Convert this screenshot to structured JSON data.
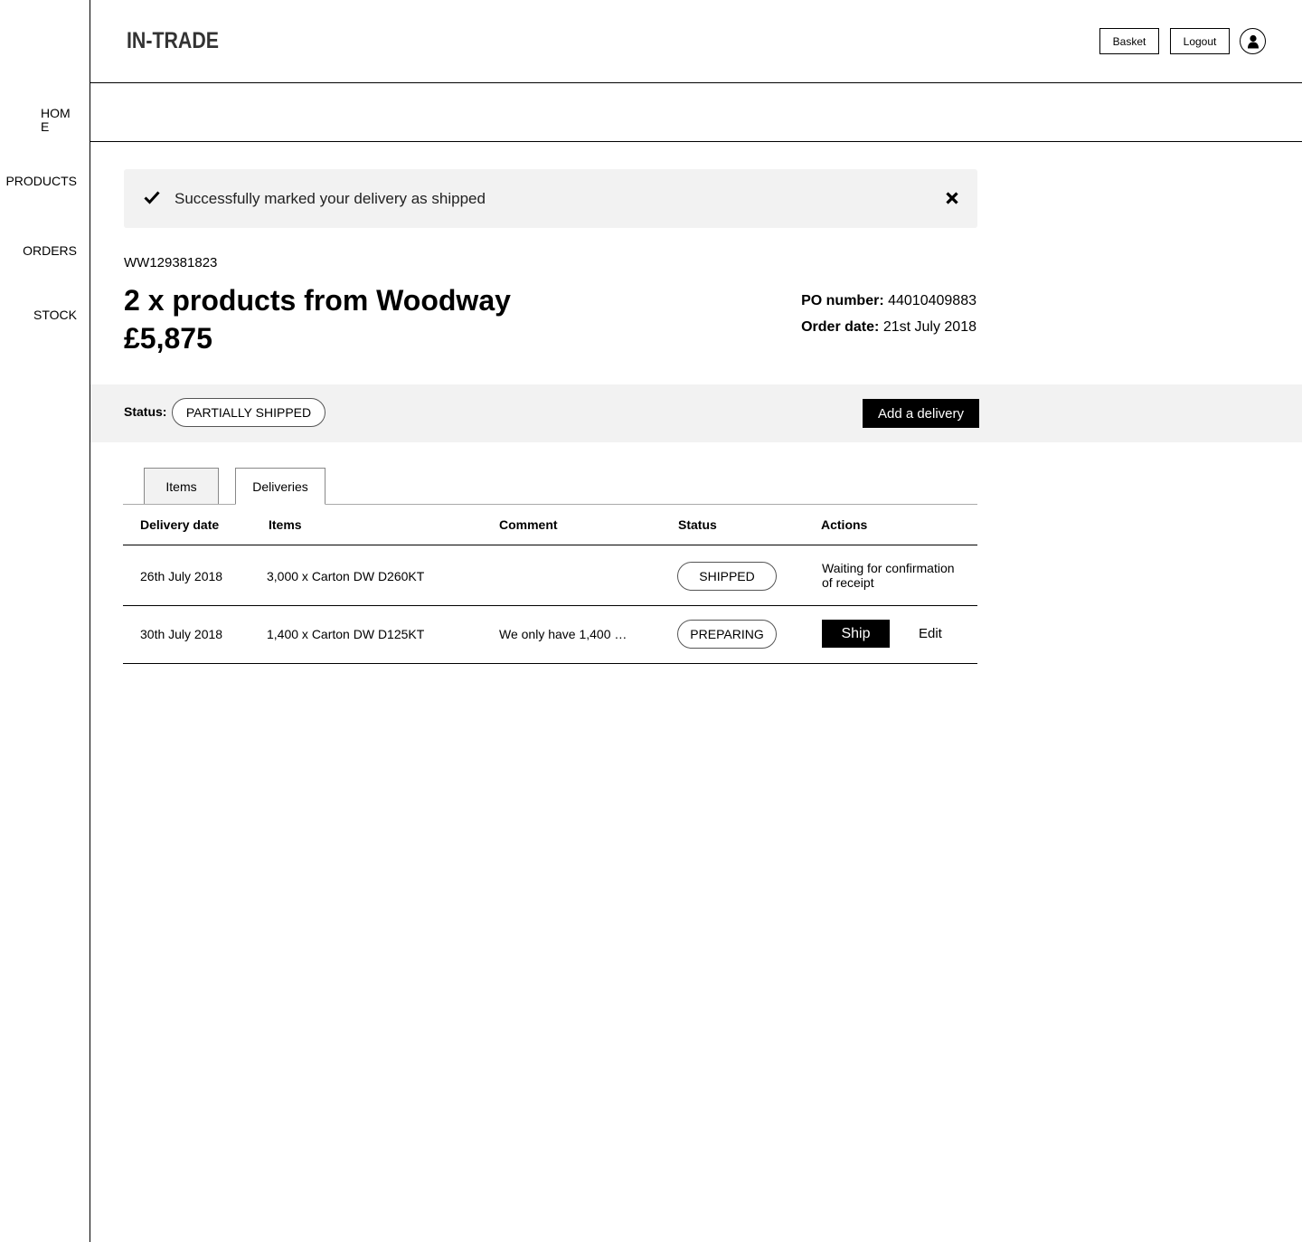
{
  "app": {
    "logo_text": "IN-TRADE"
  },
  "sidebar": {
    "items": [
      {
        "label_line1": "HOM",
        "label_line2": "E"
      },
      {
        "label": "PRODUCTS"
      },
      {
        "label": "ORDERS"
      },
      {
        "label": "STOCK"
      }
    ]
  },
  "header": {
    "basket_label": "Basket",
    "logout_label": "Logout",
    "avatar_icon": "user-icon"
  },
  "alert": {
    "message": "Successfully marked your delivery as shipped",
    "icon": "check-icon",
    "close_icon": "close-icon"
  },
  "order": {
    "reference": "WW129381823",
    "title": "2 x products from Woodway",
    "total": "£5,875",
    "po_label": "PO number:",
    "po_value": "44010409883",
    "date_label": "Order date:",
    "date_value": "21st July 2018",
    "status_label": "Status:",
    "status_value": "PARTIALLY SHIPPED",
    "add_delivery_label": "Add a delivery"
  },
  "tabs": [
    {
      "label": "Items"
    },
    {
      "label": "Deliveries"
    }
  ],
  "deliveries": {
    "columns": [
      "Delivery date",
      "Items",
      "Comment",
      "Status",
      "Actions"
    ],
    "rows": [
      {
        "date": "26th July 2018",
        "items": "3,000 x Carton DW D260KT",
        "comment": "",
        "status": "SHIPPED",
        "action_text": "Waiting for confirmation of receipt"
      },
      {
        "date": "30th July 2018",
        "items": "1,400 x Carton DW D125KT",
        "comment": "We only have 1,400 …",
        "status": "PREPARING",
        "ship_label": "Ship",
        "edit_label": "Edit"
      }
    ]
  }
}
